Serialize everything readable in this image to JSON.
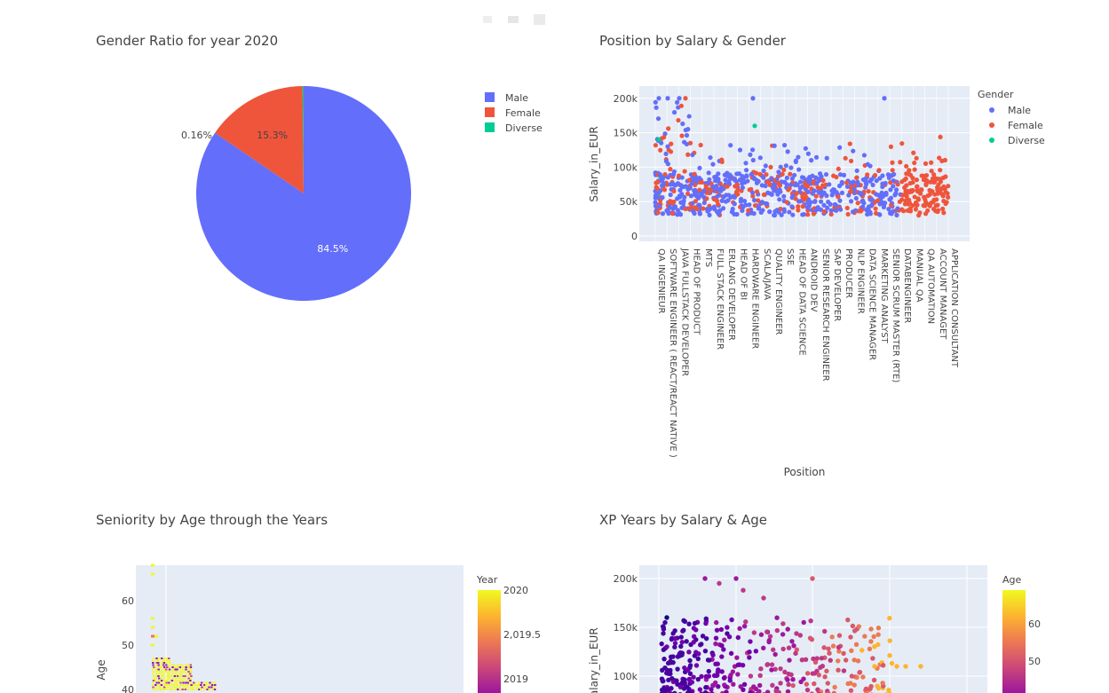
{
  "colors": {
    "male": "#636efa",
    "female": "#ef553b",
    "diverse": "#00cc96",
    "plot_bg": "#e5ecf6"
  },
  "chart_data": [
    {
      "type": "pie",
      "title": "Gender Ratio for year 2020",
      "labels": [
        "Male",
        "Female",
        "Diverse"
      ],
      "values": [
        84.5,
        15.3,
        0.16
      ],
      "value_labels": [
        "84.5%",
        "15.3%",
        "0.16%"
      ],
      "legend_placement": "top-right"
    },
    {
      "type": "scatter",
      "title": "Position by Salary & Gender",
      "xlabel": "Position",
      "ylabel": "Salary_in_EUR",
      "ytick_labels": [
        "0",
        "50k",
        "100k",
        "150k",
        "200k"
      ],
      "ylim": [
        0,
        210000
      ],
      "legend_title": "Gender",
      "legend_placement": "right",
      "series": [
        {
          "name": "Male"
        },
        {
          "name": "Female"
        },
        {
          "name": "Diverse"
        }
      ],
      "x_tick_labels": [
        "QA INGENIEUR",
        "SOFTWARE ENGINEER ( REACT/REACT NATIVE )",
        "JAVA FULLSTACK DEVELOPER",
        "HEAD OF PRODUCT",
        "MTS",
        "FULL STACK ENGINEER",
        "ERLANG DEVELOPER",
        "HEAD OF BI",
        "HARDWARE ENGINEER",
        "SCALA/JAVA",
        "QUALITY ENGINEER",
        "SSE",
        "HEAD OF DATA SCIENCE",
        "ANDROID DEV",
        "SENIOR RESEARCH ENGINEER",
        "SAP DEVELOPER",
        "PRODUCER",
        "NLP ENGINEER",
        "DATA SCIENCE MANAGER",
        "MARKETING ANALYST",
        "SENIOR SCRUM MASTER (RTE)",
        "DATABENGINEER",
        "MANUAL QA",
        "QA AUTOMATION",
        "ACCOUNT MANAGET",
        "APPLICATION CONSULTANT"
      ],
      "grid": true
    },
    {
      "type": "heatmap",
      "title": "Seniority by Age through the Years",
      "ylabel": "Age",
      "ytick_labels": [
        "40",
        "50",
        "60"
      ],
      "ylim": [
        38,
        68
      ],
      "colorbar_title": "Year",
      "colorbar_tick_labels": [
        "2020",
        "2,019.5",
        "2019"
      ]
    },
    {
      "type": "scatter",
      "title": "XP Years by Salary & Age",
      "ylabel": "Salary_in_EUR",
      "ytick_labels": [
        "100k",
        "150k",
        "200k"
      ],
      "ylim": [
        80000,
        210000
      ],
      "colorbar_title": "Age",
      "colorbar_tick_labels": [
        "60",
        "50"
      ]
    }
  ]
}
